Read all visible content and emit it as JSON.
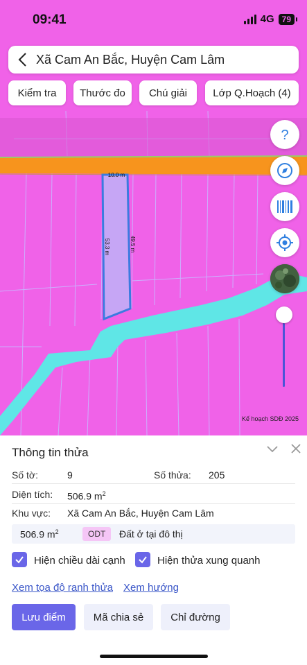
{
  "status_bar": {
    "time": "09:41",
    "network": "4G",
    "battery": "79"
  },
  "header": {
    "title": "Xã Cam An Bắc, Huyện Cam Lâm"
  },
  "toolbar": {
    "check": "Kiểm tra",
    "measure": "Thước đo",
    "legend": "Chú giải",
    "layer": "Lớp Q.Hoạch (4)"
  },
  "map": {
    "credit": "Kế hoạch SDĐ 2025",
    "edge_top": "10.0 m",
    "edge_left": "53.3 m",
    "edge_right": "49.5 m",
    "land_color": "#f062e8",
    "road_color": "#f7941d",
    "water_color": "#5fe6e6",
    "parcel_outline": "#3b7be0"
  },
  "controls": {
    "help": "help-icon",
    "compass": "compass-icon",
    "barcode": "barcode-icon",
    "locate": "locate-icon"
  },
  "sheet": {
    "title": "Thông tin thửa",
    "sheet_no_label": "Số tờ:",
    "sheet_no": "9",
    "parcel_no_label": "Số thửa:",
    "parcel_no": "205",
    "area_label": "Diện tích:",
    "area": "506.9 m",
    "area_sup": "2",
    "region_label": "Khu vực:",
    "region": "Xã Cam An Bắc, Huyện Cam Lâm",
    "use_area": "506.9 m",
    "use_area_sup": "2",
    "use_code": "ODT",
    "use_desc": "Đất ở tại đô thị",
    "show_edges": "Hiện chiều dài cạnh",
    "show_neighbors": "Hiện thửa xung quanh",
    "link_coords": "Xem tọa độ ranh thửa",
    "link_direction": "Xem hướng",
    "save_point": "Lưu điểm",
    "share_code": "Mã chia sẻ",
    "directions": "Chỉ đường"
  },
  "accent": "#6a66e8"
}
